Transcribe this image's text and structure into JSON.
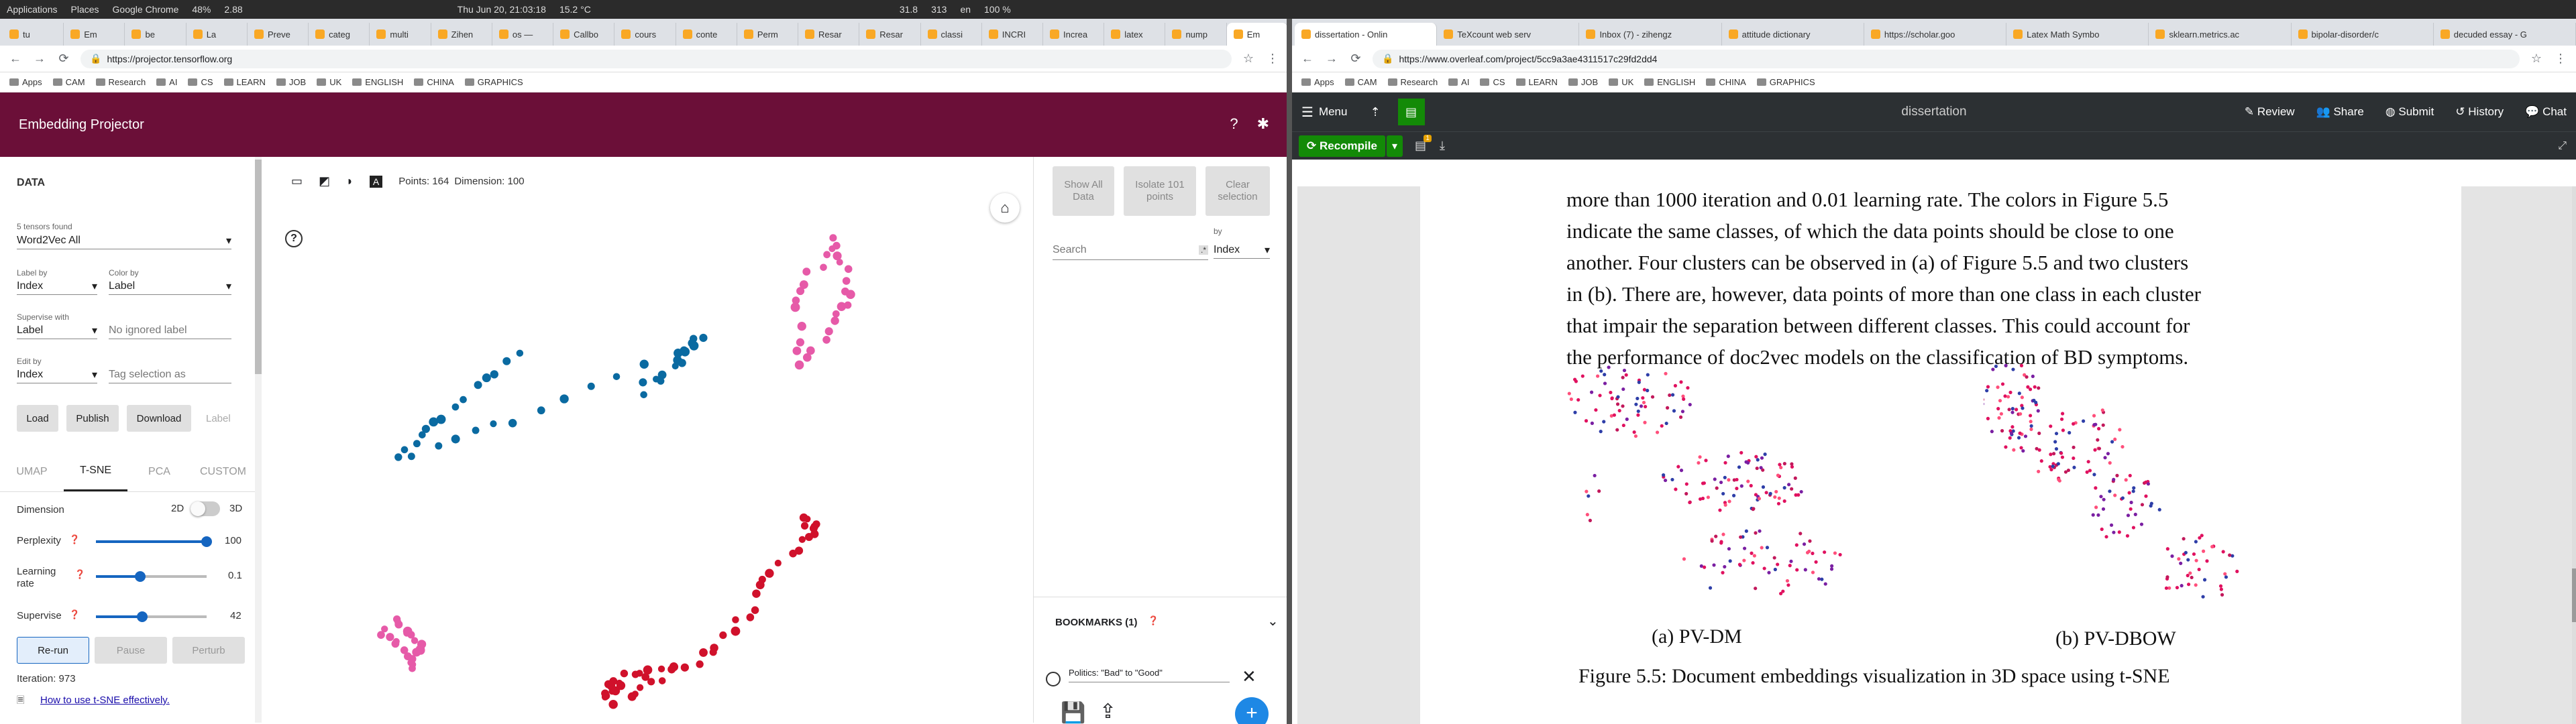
{
  "system": {
    "applications": "Applications",
    "places": "Places",
    "active_app": "Google Chrome",
    "cpu": "48%",
    "load": "2.88",
    "clock": "Thu Jun 20, 21:03:18",
    "temp": "15.2 °C",
    "net1": "31.8",
    "net2": "313",
    "lang": "en",
    "battery": "100 %"
  },
  "left_browser": {
    "tabs": [
      "tu",
      "Em",
      "be",
      "La",
      "Preve",
      "categ",
      "multi",
      "Zihen",
      "os —",
      "Callbo",
      "cours",
      "conte",
      "Perm",
      "Resar",
      "Resar",
      "classi",
      "INCRI",
      "Increa",
      "latex",
      "nump",
      "Em"
    ],
    "url": "https://projector.tensorflow.org",
    "bookmarks": [
      "Apps",
      "CAM",
      "Research",
      "AI",
      "CS",
      "LEARN",
      "JOB",
      "UK",
      "ENGLISH",
      "CHINA",
      "GRAPHICS"
    ]
  },
  "projector": {
    "title": "Embedding Projector",
    "data_section": "DATA",
    "tensors_found": "5 tensors found",
    "tensor": "Word2Vec All",
    "label_by_label": "Label by",
    "label_by": "Index",
    "color_by_label": "Color by",
    "color_by": "Label",
    "supervise_with_label": "Supervise with",
    "supervise_with": "Label",
    "ignored_placeholder": "No ignored label",
    "edit_by_label": "Edit by",
    "edit_by": "Index",
    "tag_placeholder": "Tag selection as",
    "buttons": {
      "load": "Load",
      "publish": "Publish",
      "download": "Download",
      "label": "Label"
    },
    "tabs": [
      "UMAP",
      "T-SNE",
      "PCA",
      "CUSTOM"
    ],
    "dimension_label": "Dimension",
    "dim2": "2D",
    "dim3": "3D",
    "perplexity_label": "Perplexity",
    "perplexity": "100",
    "perplexity_level": 1.0,
    "learning_rate_label": "Learning rate",
    "learning_rate": "0.1",
    "learning_rate_level": 0.4,
    "supervise_label": "Supervise",
    "supervise": "42",
    "supervise_level": 0.42,
    "rerun": "Re-run",
    "pause": "Pause",
    "perturb": "Perturb",
    "iteration": "Iteration: 973",
    "help_link": "How to use t-SNE effectively.",
    "points": "Points: 164",
    "dimension": "Dimension: 100",
    "show_all": "Show All Data",
    "isolate": "Isolate 101 points",
    "clear": "Clear selection",
    "search_placeholder": "Search",
    "by_label": "by",
    "by": "Index",
    "bookmarks_title": "BOOKMARKS (1)",
    "bookmark_item": "Politics: \"Bad\" to \"Good\"",
    "colors": {
      "header": "#6b0f38",
      "accent": "#1565c0",
      "blue": "#0a6aa1",
      "red": "#d0112b",
      "pink": "#e65aa8"
    }
  },
  "right_browser": {
    "tabs": [
      "dissertation - Onlin",
      "TeXcount web serv",
      "Inbox (7) - zihengz",
      "attitude dictionary",
      "https://scholar.goo",
      "Latex Math Symbo",
      "sklearn.metrics.ac",
      "bipolar-disorder/c",
      "decuded essay - G"
    ],
    "url": "https://www.overleaf.com/project/5cc9a3ae4311517c29fd2dd4",
    "bookmarks": [
      "Apps",
      "CAM",
      "Research",
      "AI",
      "CS",
      "LEARN",
      "JOB",
      "UK",
      "ENGLISH",
      "CHINA",
      "GRAPHICS"
    ]
  },
  "overleaf": {
    "menu": "Menu",
    "project": "dissertation",
    "review": "Review",
    "share": "Share",
    "submit": "Submit",
    "history": "History",
    "chat": "Chat",
    "recompile": "Recompile",
    "badge": "1",
    "lines": [
      "more than 1000 iteration and 0.01 learning rate.  The colors in Figure 5.5",
      "indicate the same classes, of which the data points should be close to one",
      "another. Four clusters can be observed in (a) of Figure 5.5 and two clusters",
      "in (b). There are, however, data points of more than one class in each cluster",
      "that impair the separation between different classes. This could account for",
      "the performance of doc2vec models on the classification of BD symptoms."
    ],
    "sub_a": "(a) PV-DM",
    "sub_b": "(b) PV-DBOW",
    "caption": "Figure 5.5: Document embeddings visualization in 3D space using t-SNE"
  }
}
